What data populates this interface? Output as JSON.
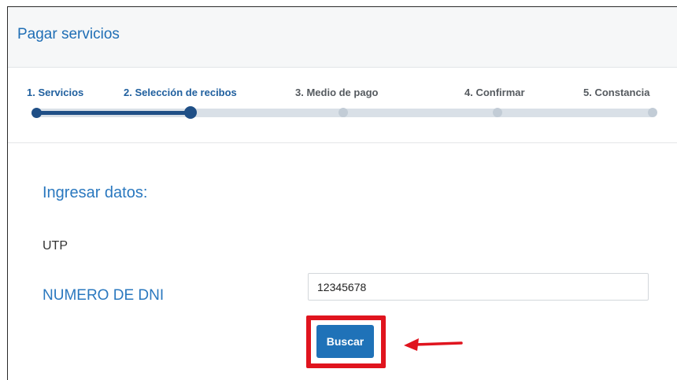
{
  "header": {
    "title": "Pagar servicios"
  },
  "stepper": {
    "current_step": 2,
    "steps": [
      {
        "label": "1. Servicios"
      },
      {
        "label": "2. Selección de recibos"
      },
      {
        "label": "3. Medio de pago"
      },
      {
        "label": "4. Confirmar"
      },
      {
        "label": "5. Constancia"
      }
    ]
  },
  "form": {
    "section_title": "Ingresar datos:",
    "service_name": "UTP",
    "dni_label": "NUMERO DE DNI",
    "dni_value": "12345678",
    "search_button": "Buscar"
  },
  "annotation": {
    "highlight_color": "#e0141e",
    "arrow_icon": "left-arrow-icon"
  },
  "colors": {
    "accent": "#1f72b8",
    "title_blue": "#2a78bf",
    "progress": "#1f4f86"
  }
}
